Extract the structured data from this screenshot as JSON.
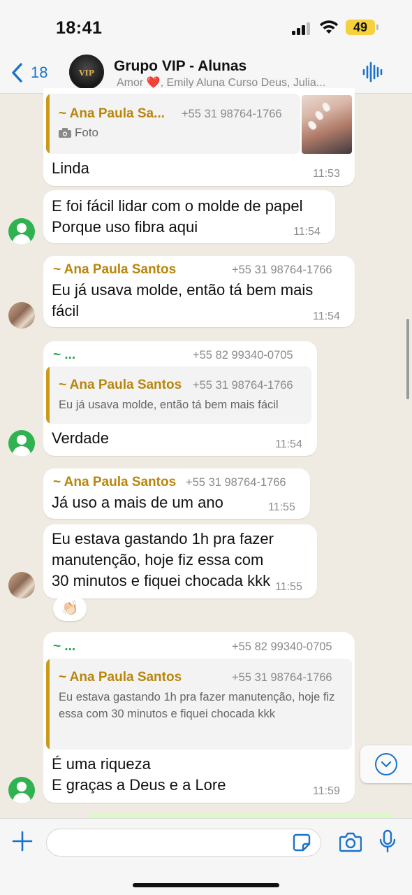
{
  "status_bar": {
    "time": "18:41",
    "battery": "49"
  },
  "header": {
    "back_count": "18",
    "group_name": "Grupo VIP - Alunas",
    "members_prefix": "Amor",
    "members_suffix": ", Emily Aluna Curso Deus, Julia...",
    "avatar_label": "VIP"
  },
  "messages": [
    {
      "quote": {
        "sender": "~ Ana Paula Sa...",
        "phone": "+55 31 98764-1766",
        "media": "Foto"
      },
      "text": "Linda",
      "time": "11:53"
    },
    {
      "text": "E foi fácil lidar com o molde de papel\nPorque uso fibra aqui",
      "time": "11:54"
    },
    {
      "sender": "~ Ana Paula Santos",
      "phone": "+55 31 98764-1766",
      "text": "Eu já usava molde, então tá bem mais fácil",
      "time": "11:54"
    },
    {
      "sender": "~ ...",
      "phone": "+55 82 99340-0705",
      "quote": {
        "sender": "~ Ana Paula Santos",
        "phone": "+55 31 98764-1766",
        "text": "Eu já usava molde, então tá bem mais fácil"
      },
      "text": "Verdade",
      "time": "11:54"
    },
    {
      "sender": "~ Ana Paula Santos",
      "phone": "+55 31 98764-1766",
      "text": "Já uso a mais de um ano",
      "time": "11:55"
    },
    {
      "text": "Eu estava gastando 1h pra fazer manutenção, hoje fiz essa com 30 minutos e fiquei chocada kkk",
      "time": "11:55",
      "reaction": "👏🏻"
    },
    {
      "sender": "~ ...",
      "phone": "+55 82 99340-0705",
      "quote": {
        "sender": "~ Ana Paula Santos",
        "phone": "+55 31 98764-1766",
        "text": "Eu estava gastando 1h pra fazer manutenção, hoje fiz essa com 30 minutos e fiquei chocada kkk"
      },
      "text": "É uma riqueza\nE graças a Deus e a Lore",
      "time": "11:59"
    }
  ],
  "input": {
    "placeholder": ""
  },
  "colors": {
    "accent": "#1a73c9",
    "sender_gold": "#b8860b",
    "sender_green": "#1ea84a",
    "chat_bg": "#efeae2",
    "avatar_green": "#2fb24f"
  },
  "icons": [
    "back-chevron-icon",
    "voice-call-icon",
    "camera-icon",
    "plus-icon",
    "sticker-icon",
    "microphone-icon",
    "chevron-down-icon"
  ]
}
